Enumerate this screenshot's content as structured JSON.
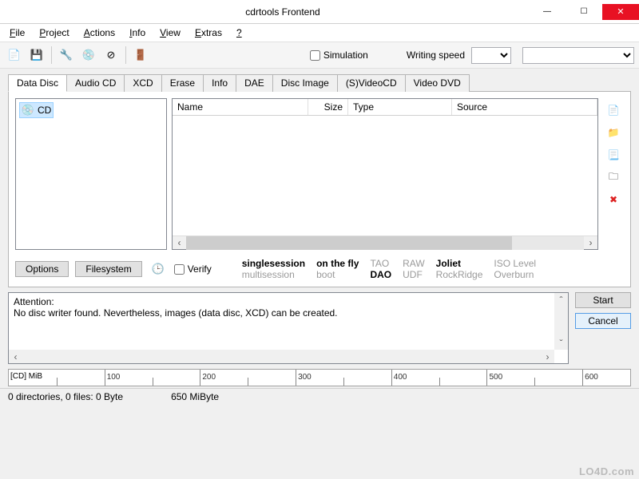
{
  "window": {
    "title": "cdrtools Frontend"
  },
  "menu": {
    "items": [
      "File",
      "Project",
      "Actions",
      "Info",
      "View",
      "Extras",
      "?"
    ]
  },
  "toolbar": {
    "icons": [
      "new-project",
      "save-project",
      "settings",
      "cd-write",
      "cd-erase",
      "exit"
    ],
    "simulation_label": "Simulation",
    "writing_speed_label": "Writing speed"
  },
  "tabs": [
    "Data Disc",
    "Audio CD",
    "XCD",
    "Erase",
    "Info",
    "DAE",
    "Disc Image",
    "(S)VideoCD",
    "Video DVD"
  ],
  "tree": {
    "root_label": "CD"
  },
  "list": {
    "columns": [
      "Name",
      "Size",
      "Type",
      "Source"
    ]
  },
  "opts": {
    "options_btn": "Options",
    "filesystem_btn": "Filesystem",
    "verify_label": "Verify"
  },
  "info_grid": {
    "row1": [
      "singlesession",
      "on the fly",
      "TAO",
      "RAW",
      "Joliet",
      "ISO Level"
    ],
    "row2": [
      "multisession",
      "boot",
      "DAO",
      "UDF",
      "RockRidge",
      "Overburn"
    ],
    "bold_indices_row1": [
      0,
      1,
      4
    ],
    "bold_indices_row2": [
      2
    ]
  },
  "message": {
    "heading": "Attention:",
    "body": "No disc writer found. Nevertheless, images (data disc, XCD) can be created."
  },
  "actions": {
    "start": "Start",
    "cancel": "Cancel"
  },
  "ruler": {
    "unit_label": "[CD] MiB",
    "ticks": [
      50,
      100,
      150,
      200,
      250,
      300,
      350,
      400,
      450,
      500,
      550,
      600
    ],
    "label_every": 2
  },
  "status": {
    "left": "0 directories, 0 files: 0 Byte",
    "right": "650 MiByte"
  },
  "watermark": "LO4D.com"
}
